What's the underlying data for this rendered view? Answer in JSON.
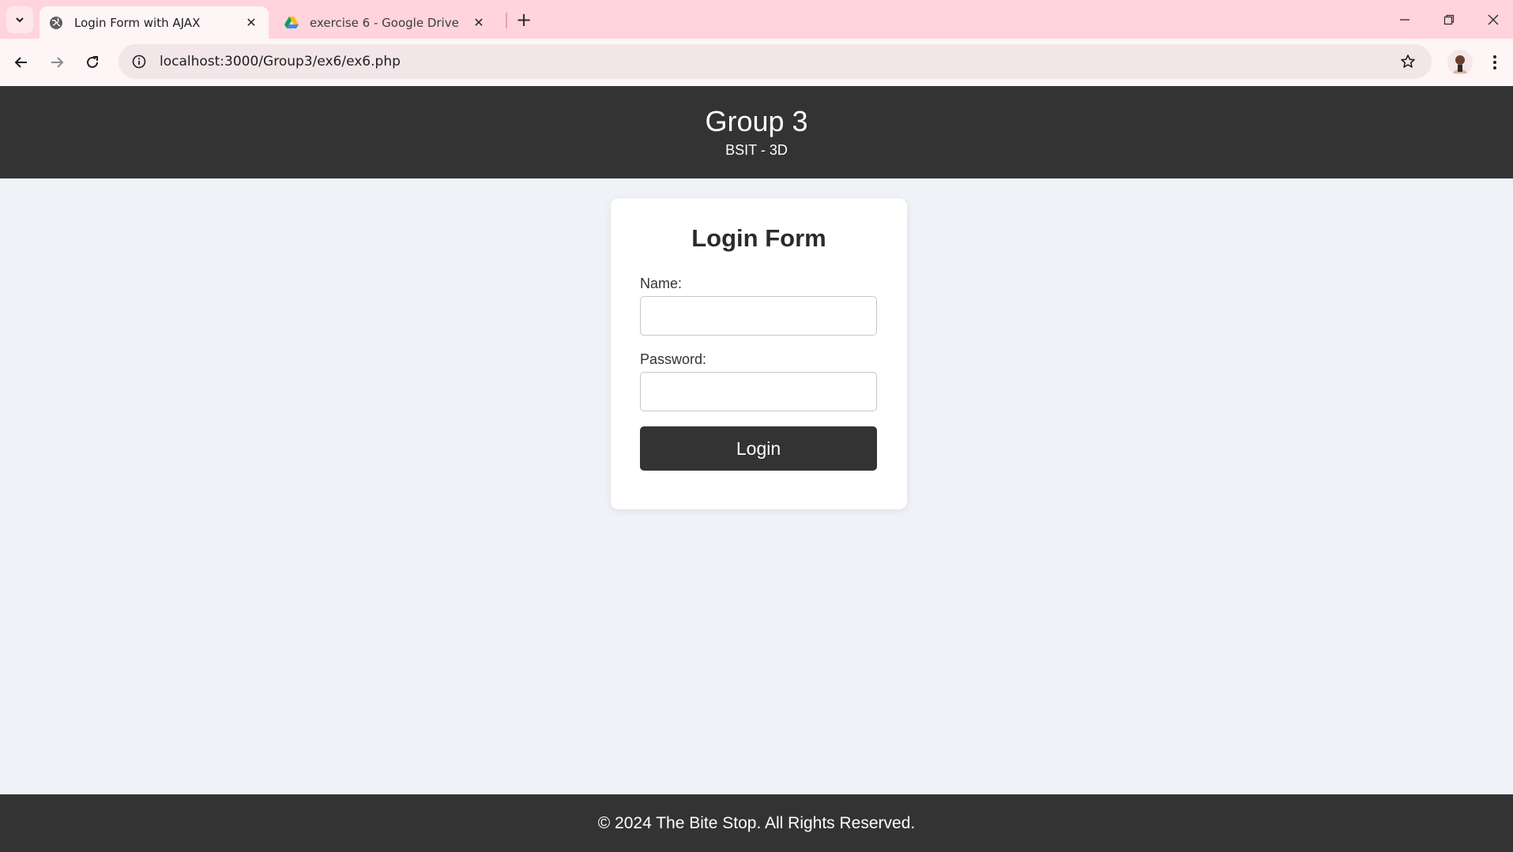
{
  "browser": {
    "tabs": [
      {
        "title": "Login Form with AJAX",
        "favicon": "globe-icon",
        "active": true
      },
      {
        "title": "exercise 6 - Google Drive",
        "favicon": "google-drive-icon",
        "active": false
      }
    ],
    "url": "localhost:3000/Group3/ex6/ex6.php",
    "colors": {
      "tabbar": "#ffd4dc",
      "toolbar": "#fdf5f6",
      "omnibox": "#f3e6e9"
    }
  },
  "header": {
    "title": "Group 3",
    "subtitle": "BSIT - 3D"
  },
  "login_form": {
    "title": "Login Form",
    "name_label": "Name:",
    "name_value": "",
    "password_label": "Password:",
    "password_value": "",
    "submit_label": "Login"
  },
  "footer": {
    "text": "© 2024 The Bite Stop. All Rights Reserved."
  },
  "colors": {
    "header_bg": "#333333",
    "page_bg": "#eff2f7",
    "card_bg": "#ffffff",
    "button_bg": "#333333"
  }
}
